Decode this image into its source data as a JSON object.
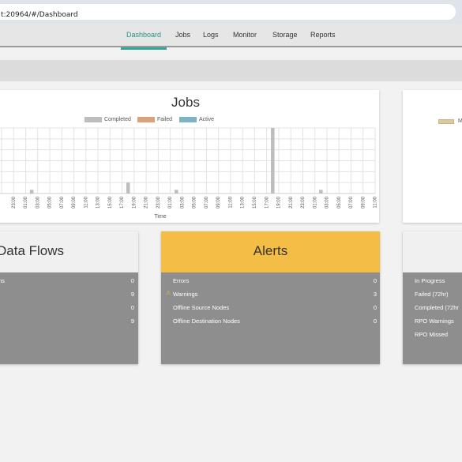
{
  "browser": {
    "url": "t:20964/#/Dashboard"
  },
  "nav": {
    "items": [
      "Dashboard",
      "Jobs",
      "Logs",
      "Monitor",
      "Storage",
      "Reports"
    ],
    "active": "Dashboard"
  },
  "jobs": {
    "title": "Jobs",
    "legend": [
      "Completed",
      "Failed",
      "Active"
    ],
    "colors": {
      "completed": "#bdbdbd",
      "failed": "#d9a27c",
      "active": "#7fb2c2"
    },
    "xlabel": "Time"
  },
  "chart_data": {
    "type": "bar",
    "title": "Jobs",
    "xlabel": "Time",
    "ylabel": "",
    "categories": [
      "",
      "23:00",
      "01:00",
      "03:00",
      "05:00",
      "07:00",
      "09:00",
      "11:00",
      "13:00",
      "15:00",
      "17:00",
      "19:00",
      "21:00",
      "23:00",
      "01:00",
      "03:00",
      "05:00",
      "07:00",
      "09:00",
      "11:00",
      "13:00",
      "15:00",
      "17:00",
      "19:00",
      "21:00",
      "23:00",
      "01:00",
      "03:00",
      "05:00",
      "07:00",
      "09:00",
      "11:00"
    ],
    "series": [
      {
        "name": "Completed",
        "values": [
          0,
          0,
          1,
          0,
          0,
          0,
          0,
          0,
          0,
          0,
          3,
          0,
          0,
          0,
          1,
          0,
          0,
          0,
          0,
          0,
          0,
          0,
          18,
          0,
          0,
          0,
          1,
          0,
          0,
          0,
          0,
          3
        ]
      },
      {
        "name": "Failed",
        "values": [
          0,
          0,
          0,
          0,
          0,
          0,
          0,
          0,
          0,
          0,
          0,
          0,
          0,
          0,
          0,
          0,
          0,
          0,
          0,
          0,
          0,
          0,
          0,
          0,
          0,
          0,
          0,
          0,
          0,
          0,
          0,
          0
        ]
      },
      {
        "name": "Active",
        "values": [
          0,
          0,
          0,
          0,
          0,
          0,
          0,
          0,
          0,
          0,
          0,
          0,
          0,
          0,
          0,
          0,
          0,
          0,
          0,
          0,
          0,
          0,
          0,
          0,
          0,
          0,
          0,
          0,
          0,
          0,
          0,
          1
        ]
      }
    ],
    "ylim": [
      0,
      18
    ],
    "grid": true,
    "legend_position": "top"
  },
  "right_top": {
    "legend_label": "M"
  },
  "data_flows": {
    "title": "Data Flows",
    "rows": [
      {
        "label": "ns",
        "value": "0"
      },
      {
        "label": "",
        "value": "9"
      },
      {
        "label": "",
        "value": "0"
      },
      {
        "label": "",
        "value": "9"
      }
    ]
  },
  "alerts": {
    "title": "Alerts",
    "rows": [
      {
        "label": "Errors",
        "value": "0"
      },
      {
        "label": "Warnings",
        "value": "3"
      },
      {
        "label": "Offline Source Nodes",
        "value": "0"
      },
      {
        "label": "Offline Destination Nodes",
        "value": "0"
      }
    ]
  },
  "rpo": {
    "rows": [
      "In Progress",
      "Failed (72hr)",
      "Completed (72hr",
      "RPO Warnings",
      "RPO Missed"
    ]
  }
}
